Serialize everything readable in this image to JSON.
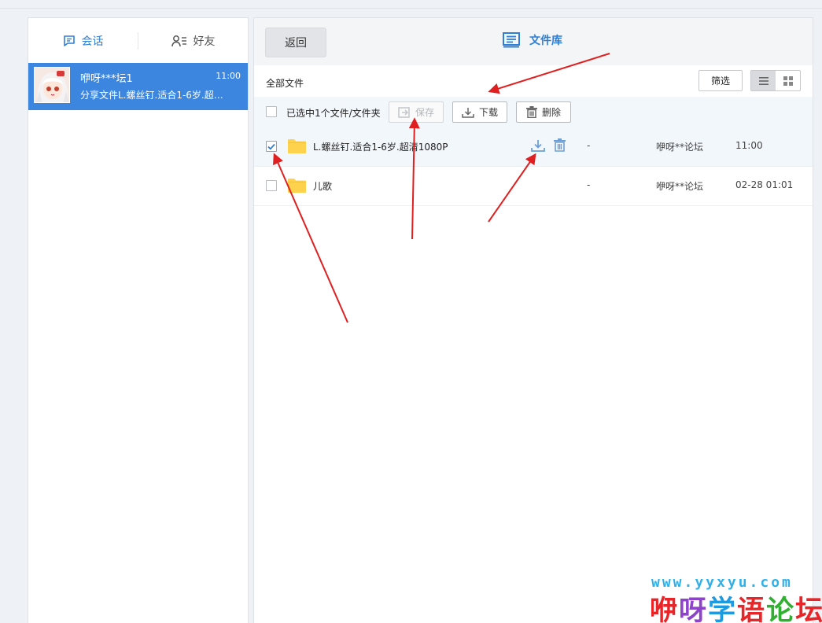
{
  "left": {
    "tabs": [
      {
        "label": "会话",
        "icon": "chat-icon",
        "active": true
      },
      {
        "label": "好友",
        "icon": "friends-icon",
        "active": false
      }
    ],
    "conversation": {
      "name": "咿呀***坛1",
      "time": "11:00",
      "preview": "分享文件L.螺丝钉.适合1-6岁.超…"
    }
  },
  "right": {
    "back_label": "返回",
    "title": "文件库",
    "title_icon": "file-library-icon",
    "all_files_label": "全部文件",
    "filter_label": "筛选",
    "toolbar": {
      "selection_text": "已选中1个文件/文件夹",
      "save_label": "保存",
      "download_label": "下载",
      "delete_label": "删除"
    },
    "files": [
      {
        "name": "L.螺丝钉.适合1-6岁.超清1080P",
        "size": "-",
        "owner": "咿呀**论坛",
        "time": "11:00",
        "checked": true
      },
      {
        "name": "儿歌",
        "size": "-",
        "owner": "咿呀**论坛",
        "time": "02-28 01:01",
        "checked": false
      }
    ]
  },
  "watermark": {
    "url": "www.yyxyu.com",
    "chars": [
      "咿",
      "呀",
      "学",
      "语",
      "论",
      "坛"
    ],
    "colors": [
      "#e8262a",
      "#8e44c8",
      "#1e9be0",
      "#e8262a",
      "#30b030",
      "#e8262a"
    ]
  },
  "colors": {
    "accent": "#2f7fd6",
    "selected_conversation": "#3c86e0",
    "annotation_arrow": "#e02020",
    "folder": "#ffd24d"
  }
}
